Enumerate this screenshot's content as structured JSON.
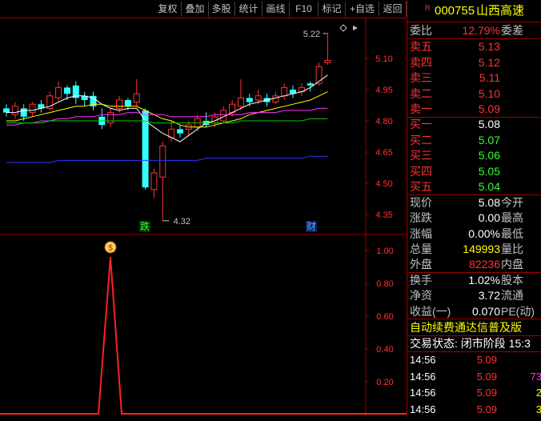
{
  "toolbar": {
    "buttons": [
      "复权",
      "叠加",
      "多股",
      "统计",
      "画线",
      "F10",
      "标记",
      "+自选",
      "返回"
    ]
  },
  "header": {
    "badge": "R",
    "code": "000755",
    "name": "山西高速"
  },
  "chart": {
    "price_axis": [
      "5.10",
      "4.95",
      "4.80",
      "4.65",
      "4.50",
      "4.35"
    ],
    "high_label": "5.22",
    "low_label": "4.32",
    "marker_die": "跌",
    "marker_cai": "财",
    "indicator_axis": [
      "1.00",
      "0.80",
      "0.60",
      "0.40",
      "0.20"
    ],
    "indicator_marker": "$"
  },
  "chart_data": {
    "type": "candlestick",
    "price_ticks": [
      5.1,
      4.95,
      4.8,
      4.65,
      4.5,
      4.35
    ],
    "candles": [
      {
        "o": 4.86,
        "c": 4.84,
        "h": 4.88,
        "l": 4.82
      },
      {
        "o": 4.83,
        "c": 4.87,
        "h": 4.89,
        "l": 4.81
      },
      {
        "o": 4.86,
        "c": 4.82,
        "h": 4.88,
        "l": 4.8
      },
      {
        "o": 4.84,
        "c": 4.88,
        "h": 4.89,
        "l": 4.82
      },
      {
        "o": 4.88,
        "c": 4.86,
        "h": 4.9,
        "l": 4.84
      },
      {
        "o": 4.86,
        "c": 4.92,
        "h": 4.94,
        "l": 4.85
      },
      {
        "o": 4.91,
        "c": 4.96,
        "h": 4.99,
        "l": 4.89
      },
      {
        "o": 4.96,
        "c": 4.93,
        "h": 4.97,
        "l": 4.9
      },
      {
        "o": 4.97,
        "c": 4.91,
        "h": 4.99,
        "l": 4.88
      },
      {
        "o": 4.92,
        "c": 4.9,
        "h": 4.94,
        "l": 4.87
      },
      {
        "o": 4.92,
        "c": 4.87,
        "h": 4.94,
        "l": 4.85
      },
      {
        "o": 4.82,
        "c": 4.78,
        "h": 4.86,
        "l": 4.76
      },
      {
        "o": 4.79,
        "c": 4.84,
        "h": 4.86,
        "l": 4.77
      },
      {
        "o": 4.86,
        "c": 4.9,
        "h": 4.92,
        "l": 4.84
      },
      {
        "o": 4.9,
        "c": 4.87,
        "h": 4.91,
        "l": 4.85
      },
      {
        "o": 4.89,
        "c": 4.93,
        "h": 5.0,
        "l": 4.87
      },
      {
        "o": 4.85,
        "c": 4.48,
        "h": 4.86,
        "l": 4.47
      },
      {
        "o": 4.47,
        "c": 4.55,
        "h": 4.57,
        "l": 4.43
      },
      {
        "o": 4.53,
        "c": 4.68,
        "h": 4.7,
        "l": 4.32
      },
      {
        "o": 4.72,
        "c": 4.76,
        "h": 4.8,
        "l": 4.7
      },
      {
        "o": 4.76,
        "c": 4.74,
        "h": 4.78,
        "l": 4.72
      },
      {
        "o": 4.76,
        "c": 4.78,
        "h": 4.8,
        "l": 4.73
      },
      {
        "o": 4.77,
        "c": 4.81,
        "h": 4.83,
        "l": 4.75
      },
      {
        "o": 4.8,
        "c": 4.78,
        "h": 4.84,
        "l": 4.77
      },
      {
        "o": 4.79,
        "c": 4.82,
        "h": 4.84,
        "l": 4.77
      },
      {
        "o": 4.8,
        "c": 4.85,
        "h": 4.87,
        "l": 4.79
      },
      {
        "o": 4.84,
        "c": 4.88,
        "h": 4.9,
        "l": 4.82
      },
      {
        "o": 4.87,
        "c": 4.91,
        "h": 5.0,
        "l": 4.85
      },
      {
        "o": 4.91,
        "c": 4.89,
        "h": 4.93,
        "l": 4.87
      },
      {
        "o": 4.9,
        "c": 4.92,
        "h": 4.95,
        "l": 4.88
      },
      {
        "o": 4.91,
        "c": 4.89,
        "h": 4.93,
        "l": 4.87
      },
      {
        "o": 4.89,
        "c": 4.92,
        "h": 4.94,
        "l": 4.88
      },
      {
        "o": 4.92,
        "c": 4.96,
        "h": 4.98,
        "l": 4.9
      },
      {
        "o": 4.95,
        "c": 4.93,
        "h": 4.97,
        "l": 4.91
      },
      {
        "o": 4.94,
        "c": 4.96,
        "h": 4.98,
        "l": 4.92
      },
      {
        "o": 4.98,
        "c": 4.97,
        "h": 4.99,
        "l": 4.94
      },
      {
        "o": 4.98,
        "c": 5.06,
        "h": 5.08,
        "l": 4.97
      },
      {
        "o": 5.08,
        "c": 5.09,
        "h": 5.22,
        "l": 5.07
      }
    ],
    "ma_lines": [
      {
        "color": "#ffffff",
        "y": [
          4.84,
          4.84,
          4.85,
          4.85,
          4.86,
          4.87,
          4.89,
          4.91,
          4.92,
          4.92,
          4.91,
          4.88,
          4.86,
          4.85,
          4.86,
          4.86,
          4.8,
          4.77,
          4.74,
          4.72,
          4.7,
          4.73,
          4.76,
          4.79,
          4.8,
          4.82,
          4.84,
          4.86,
          4.88,
          4.89,
          4.9,
          4.91,
          4.92,
          4.93,
          4.94,
          4.96,
          4.99,
          5.02
        ]
      },
      {
        "color": "#ffff00",
        "y": [
          4.8,
          4.8,
          4.81,
          4.82,
          4.83,
          4.84,
          4.85,
          4.86,
          4.87,
          4.87,
          4.88,
          4.88,
          4.87,
          4.87,
          4.87,
          4.87,
          4.85,
          4.83,
          4.81,
          4.8,
          4.78,
          4.77,
          4.77,
          4.77,
          4.78,
          4.79,
          4.8,
          4.81,
          4.83,
          4.84,
          4.85,
          4.86,
          4.87,
          4.88,
          4.89,
          4.9,
          4.92,
          4.94
        ]
      },
      {
        "color": "#ff33ff",
        "y": [
          4.78,
          4.78,
          4.79,
          4.79,
          4.8,
          4.8,
          4.81,
          4.81,
          4.82,
          4.82,
          4.82,
          4.83,
          4.83,
          4.83,
          4.84,
          4.84,
          4.83,
          4.83,
          4.83,
          4.82,
          4.82,
          4.82,
          4.82,
          4.82,
          4.83,
          4.83,
          4.83,
          4.83,
          4.84,
          4.84,
          4.84,
          4.84,
          4.85,
          4.85,
          4.85,
          4.85,
          4.86,
          4.86
        ]
      },
      {
        "color": "#00cc00",
        "y": [
          4.79,
          4.79,
          4.79,
          4.79,
          4.79,
          4.8,
          4.8,
          4.8,
          4.8,
          4.8,
          4.8,
          4.8,
          4.8,
          4.8,
          4.8,
          4.8,
          4.8,
          4.79,
          4.79,
          4.79,
          4.79,
          4.79,
          4.79,
          4.79,
          4.79,
          4.79,
          4.79,
          4.8,
          4.8,
          4.8,
          4.8,
          4.8,
          4.8,
          4.8,
          4.8,
          4.81,
          4.81,
          4.81
        ]
      },
      {
        "color": "#3333ff",
        "y": [
          4.6,
          4.6,
          4.6,
          4.6,
          4.6,
          4.6,
          4.61,
          4.61,
          4.61,
          4.61,
          4.61,
          4.61,
          4.61,
          4.61,
          4.61,
          4.61,
          4.61,
          4.61,
          4.61,
          4.61,
          4.61,
          4.61,
          4.61,
          4.62,
          4.62,
          4.62,
          4.62,
          4.62,
          4.62,
          4.62,
          4.62,
          4.62,
          4.62,
          4.62,
          4.62,
          4.63,
          4.63,
          4.63
        ]
      }
    ],
    "indicator_ticks": [
      1.0,
      0.8,
      0.6,
      0.4,
      0.2
    ],
    "indicator_x": [
      0,
      123,
      138,
      152,
      508
    ],
    "indicator_y": [
      0,
      0,
      0.96,
      0,
      0
    ]
  },
  "side": {
    "weibi_label": "委比",
    "weibi_value": "12.79%",
    "weicha_label": "委差",
    "sells": [
      {
        "label": "卖五",
        "price": "5.13"
      },
      {
        "label": "卖四",
        "price": "5.12"
      },
      {
        "label": "卖三",
        "price": "5.11"
      },
      {
        "label": "卖二",
        "price": "5.10"
      },
      {
        "label": "卖一",
        "price": "5.09"
      }
    ],
    "buys": [
      {
        "label": "买一",
        "price": "5.08"
      },
      {
        "label": "买二",
        "price": "5.07"
      },
      {
        "label": "买三",
        "price": "5.06"
      },
      {
        "label": "买四",
        "price": "5.05"
      },
      {
        "label": "买五",
        "price": "5.04"
      }
    ],
    "stats": [
      {
        "label": "现价",
        "value": "5.08",
        "label2": "今开",
        "color": "#ffffff"
      },
      {
        "label": "涨跌",
        "value": "0.00",
        "label2": "最高",
        "color": "#ffffff"
      },
      {
        "label": "涨幅",
        "value": "0.00%",
        "label2": "最低",
        "color": "#ffffff"
      },
      {
        "label": "总量",
        "value": "149993",
        "label2": "量比",
        "color": "#ffff00"
      },
      {
        "label": "外盘",
        "value": "82236",
        "label2": "内盘",
        "color": "#ff3333"
      }
    ],
    "stats2": [
      {
        "label": "换手",
        "value": "1.02%",
        "label2": "股本"
      },
      {
        "label": "净资",
        "value": "3.72",
        "label2": "流通"
      },
      {
        "label": "收益(一)",
        "value": "0.070",
        "label2": "PE(动)"
      }
    ],
    "promo": "自动续费通达信普及版",
    "status": "交易状态: 闭市阶段 15:3",
    "ticks": [
      {
        "time": "14:56",
        "price": "5.09",
        "vol": ""
      },
      {
        "time": "14:56",
        "price": "5.09",
        "vol": "73"
      },
      {
        "time": "14:56",
        "price": "5.09",
        "vol": "2"
      },
      {
        "time": "14:56",
        "price": "5.09",
        "vol": "3"
      },
      {
        "time": "14:56",
        "price": "5.09",
        "vol": ""
      }
    ]
  },
  "colors": {
    "up": "#ff3333",
    "down": "#33ffff",
    "frame": "#a00000",
    "bg": "#000000"
  }
}
